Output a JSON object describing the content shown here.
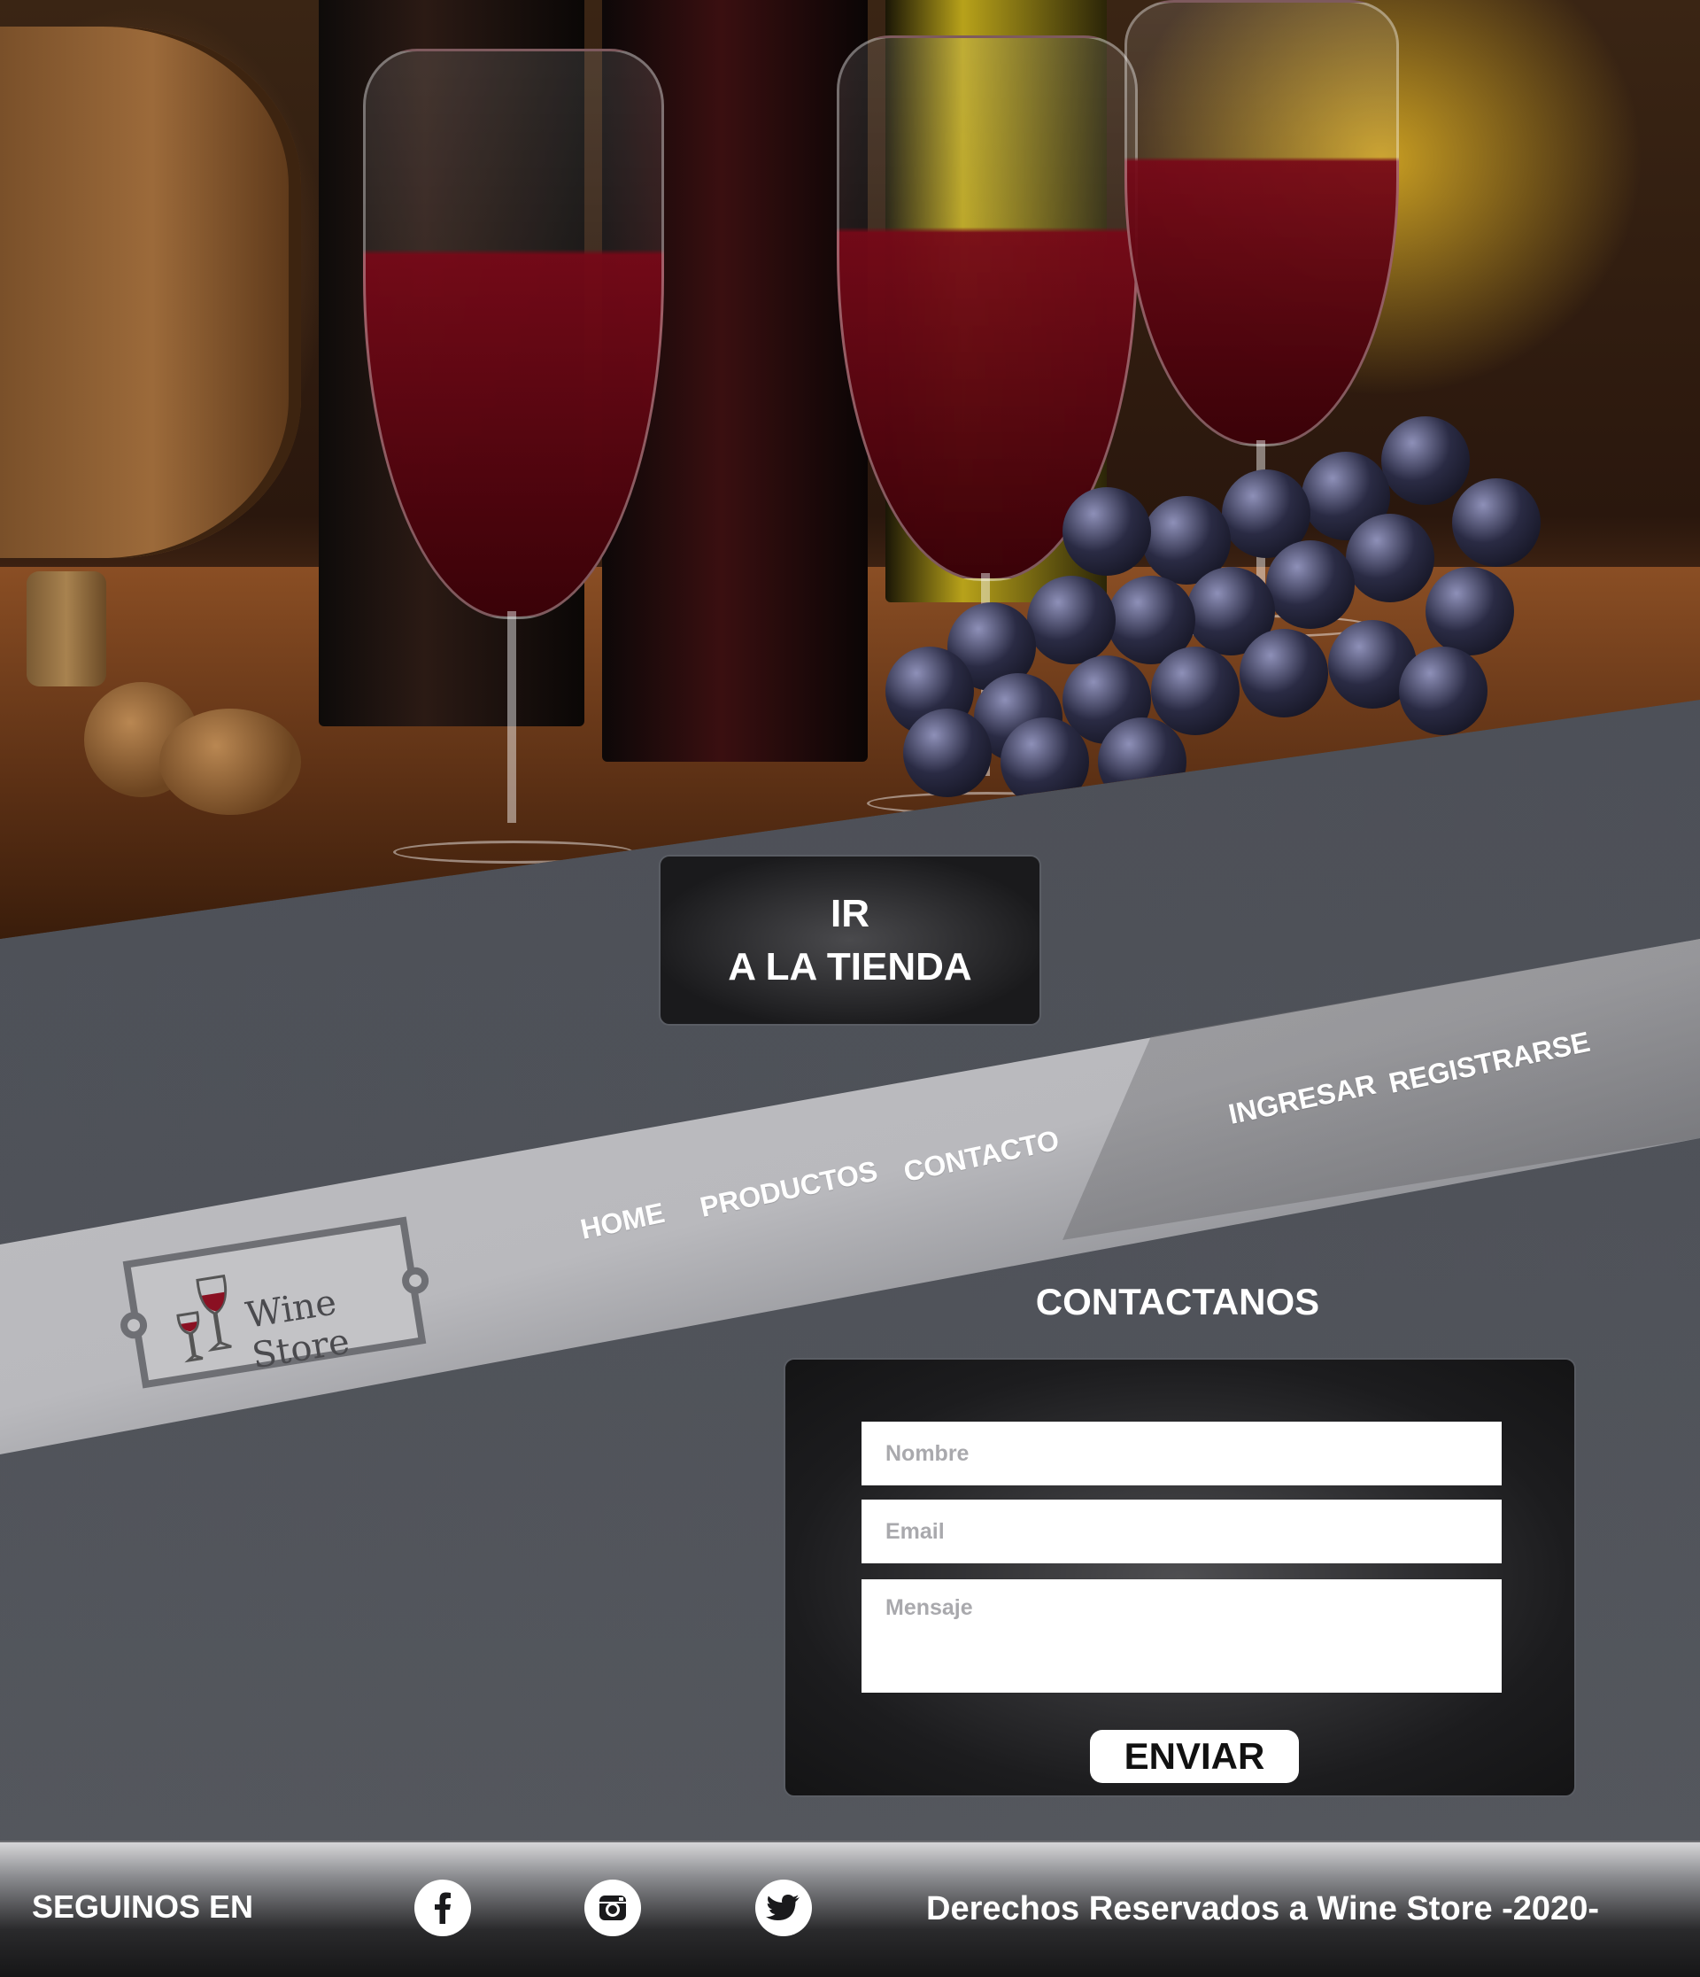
{
  "hero": {
    "shop_button": {
      "line1": "IR",
      "line2": "A LA TIENDA"
    }
  },
  "brand": {
    "logo_text": "Wine Store"
  },
  "nav": {
    "home": "HOME",
    "products": "PRODUCTOS",
    "contact": "CONTACTO",
    "login": "INGRESAR",
    "register": "REGISTRARSE"
  },
  "contact": {
    "title": "CONTACTANOS",
    "name_placeholder": "Nombre",
    "email_placeholder": "Email",
    "message_placeholder": "Mensaje",
    "send_label": "ENVIAR"
  },
  "footer": {
    "follow_label": "SEGUINOS EN",
    "social_icons": [
      "facebook-icon",
      "instagram-icon",
      "twitter-icon"
    ],
    "copyright": "Derechos Reservados a Wine Store -2020-"
  },
  "colors": {
    "background": "#4f5259",
    "band": "#b9b9bd",
    "panel": "#1c1c1e",
    "wine": "#7a0a1a"
  }
}
